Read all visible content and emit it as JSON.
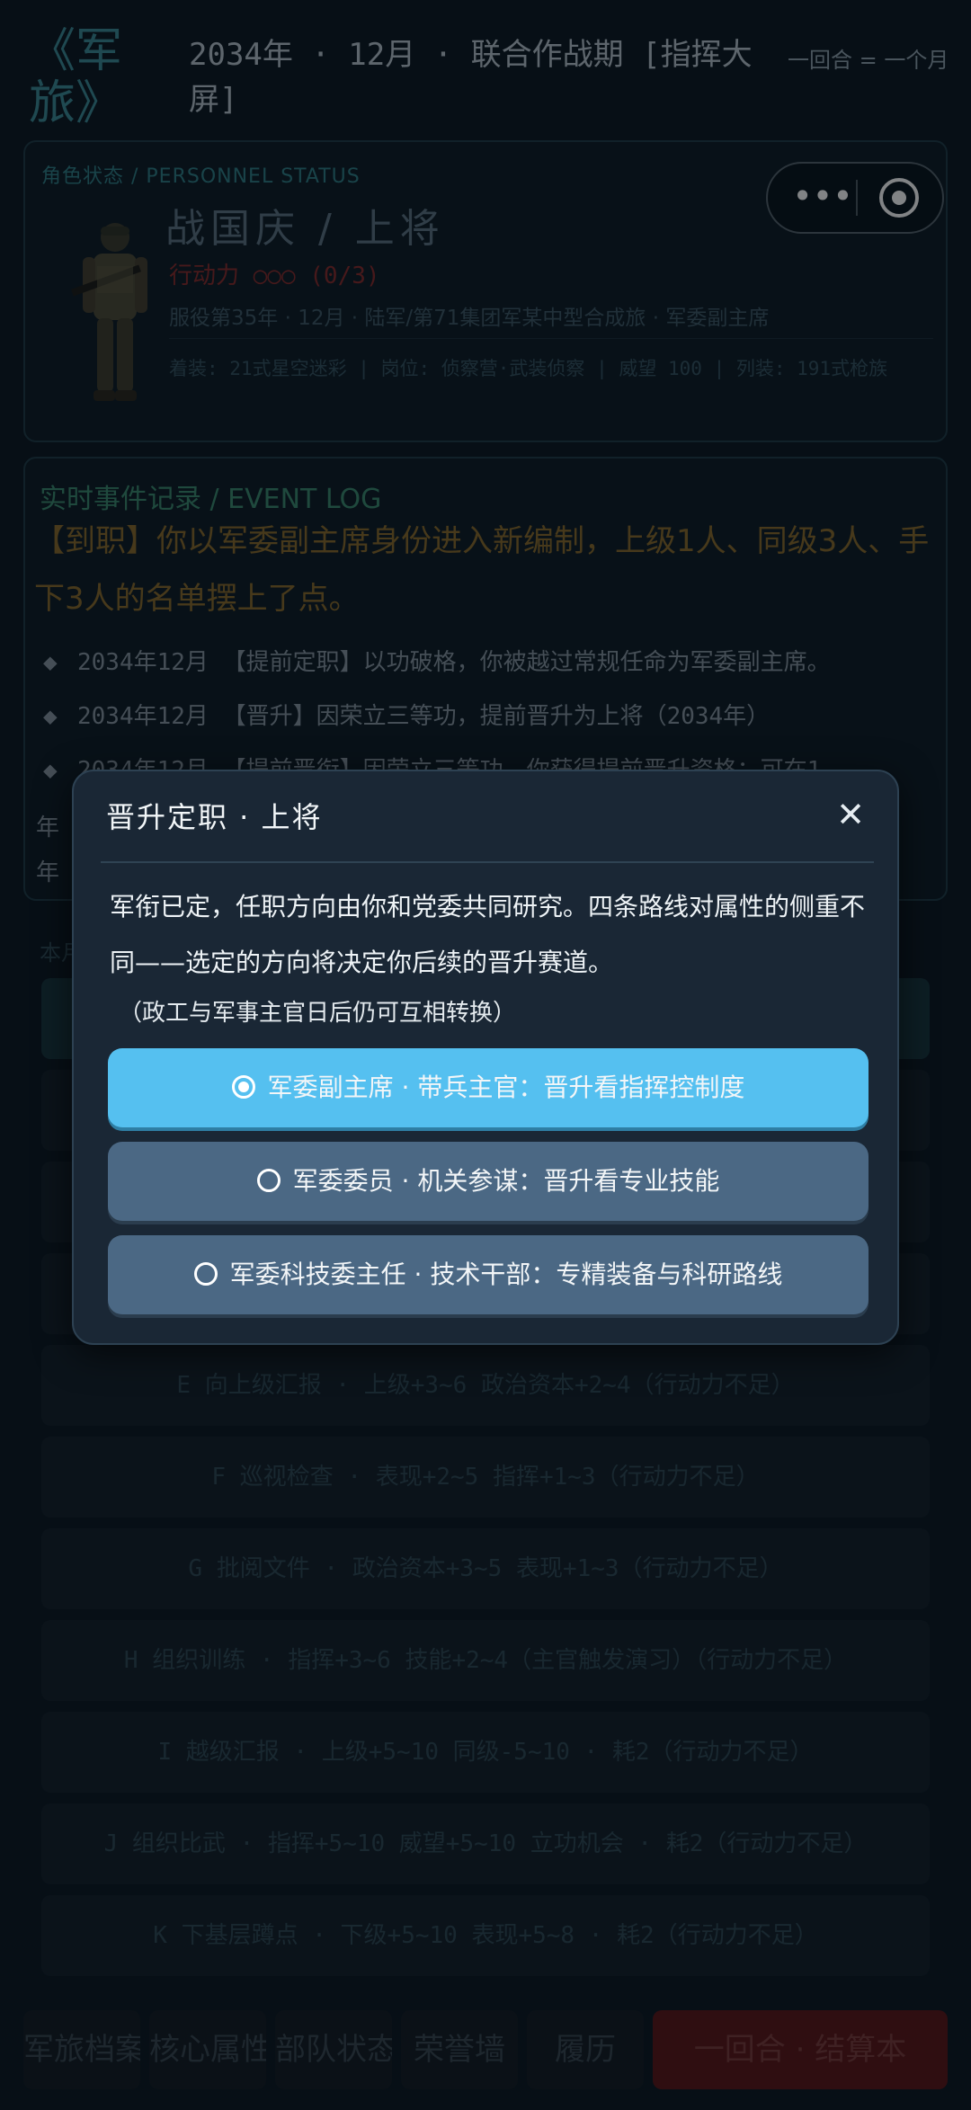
{
  "header": {
    "logo": "《军旅》",
    "subtitle": "2034年 · 12月 · 联合作战期 [指挥大屏]",
    "turn_info": "一回合 = 一个月"
  },
  "status": {
    "title": "角色状态 / PERSONNEL STATUS",
    "name": "战国庆 / 上将",
    "action_points": "行动力 ○○○ (0/3)",
    "service": "服役第35年 · 12月 · 陆军/第71集团军某中型合成旅 · 军委副主席",
    "gear": "着装: 21式星空迷彩 | 岗位: 侦察营·武装侦察 | 威望 100 | 列装: 191式枪族"
  },
  "log": {
    "title": "实时事件记录 / EVENT LOG",
    "headline": "【到职】你以军委副主席身份进入新编制，上级1人、同级3人、手下3人的名单摆上了点。",
    "items": [
      "2034年12月 【提前定职】以功破格，你被越过常规任命为军委副主席。",
      "2034年12月 【晋升】因荣立三等功，提前晋升为上将（2034年）",
      "2034年12月 【提前晋衔】因荣立三等功，你获得提前晋升资格：可在1",
      "年",
      "年"
    ]
  },
  "actions": {
    "label": "本月",
    "items": [
      "",
      "",
      "",
      "",
      "E  向上级汇报 · 上级+3~6 政治资本+2~4（行动力不足）",
      "F  巡视检查 · 表现+2~5 指挥+1~3（行动力不足）",
      "G  批阅文件 · 政治资本+3~5 表现+1~3（行动力不足）",
      "H  组织训练 · 指挥+3~6 技能+2~4（主官触发演习）（行动力不足）",
      "I  越级汇报 · 上级+5~10 同级-5~10 · 耗2（行动力不足）",
      "J  组织比武 · 指挥+5~10 威望+5~10 立功机会 · 耗2（行动力不足）",
      "K  下基层蹲点 · 下级+5~10 表现+5~8 · 耗2（行动力不足）"
    ]
  },
  "nav": {
    "archive": "军旅档案",
    "attributes": "核心属性",
    "unit": "部队状态",
    "honors": "荣誉墙",
    "resume": "履历",
    "end_turn": "一回合 · 结算本"
  },
  "modal": {
    "title": "晋升定职 · 上将",
    "close": "✕",
    "body": "军衔已定，任职方向由你和党委共同研究。四条路线对属性的侧重不同——选定的方向将决定你后续的晋升赛道。",
    "note": "（政工与军事主官日后仍可互相转换）",
    "options": [
      {
        "label": "军委副主席 · 带兵主官：晋升看指挥控制度",
        "selected": true
      },
      {
        "label": "军委委员 · 机关参谋：晋升看专业技能",
        "selected": false
      },
      {
        "label": "军委科技委主任 · 技术干部：专精装备与科研路线",
        "selected": false
      }
    ]
  },
  "colors": {
    "accent": "#55c0f0",
    "option": "#4b6884",
    "warning": "#8a2a2a",
    "gold": "#8a6a2a"
  }
}
